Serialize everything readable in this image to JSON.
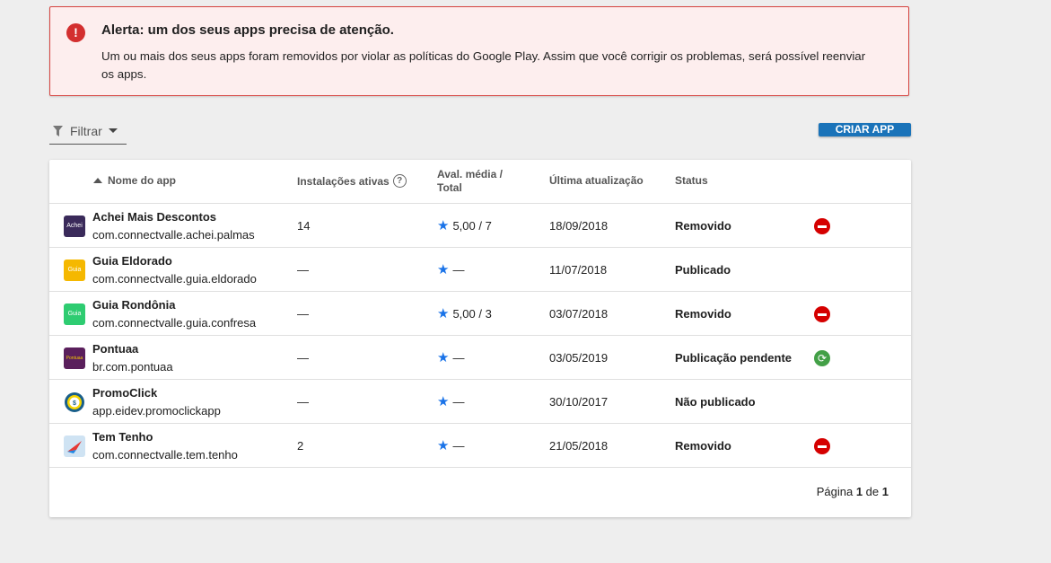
{
  "alert": {
    "icon": "error-icon",
    "title": "Alerta: um dos seus apps precisa de atenção.",
    "body": "Um ou mais dos seus apps foram removidos por violar as políticas do Google Play. Assim que você corrigir os problemas, será possível reenviar os apps."
  },
  "toolbar": {
    "filter_label": "Filtrar",
    "create_label": "CRIAR APP"
  },
  "table": {
    "headers": {
      "name": "Nome do app",
      "installs": "Instalações ativas",
      "rating": "Aval. média / Total",
      "updated": "Última atualização",
      "status": "Status"
    },
    "rows": [
      {
        "name": "Achei Mais Descontos",
        "package": "com.connectvalle.achei.palmas",
        "installs": "14",
        "rating": "5,00 / 7",
        "updated": "18/09/2018",
        "status": "Removido",
        "status_icon": "removed-icon",
        "icon_text": "Achei"
      },
      {
        "name": "Guia Eldorado",
        "package": "com.connectvalle.guia.eldorado",
        "installs": "—",
        "rating": "—",
        "updated": "11/07/2018",
        "status": "Publicado",
        "status_icon": "",
        "icon_text": "Guia"
      },
      {
        "name": "Guia Rondônia",
        "package": "com.connectvalle.guia.confresa",
        "installs": "—",
        "rating": "5,00 / 3",
        "updated": "03/07/2018",
        "status": "Removido",
        "status_icon": "removed-icon",
        "icon_text": "Guia"
      },
      {
        "name": "Pontuaa",
        "package": "br.com.pontuaa",
        "installs": "—",
        "rating": "—",
        "updated": "03/05/2019",
        "status": "Publicação pendente",
        "status_icon": "pending-icon",
        "icon_text": "Pontuaa"
      },
      {
        "name": "PromoClick",
        "package": "app.eidev.promoclickapp",
        "installs": "—",
        "rating": "—",
        "updated": "30/10/2017",
        "status": "Não publicado",
        "status_icon": "",
        "icon_text": ""
      },
      {
        "name": "Tem Tenho",
        "package": "com.connectvalle.tem.tenho",
        "installs": "2",
        "rating": "—",
        "updated": "21/05/2018",
        "status": "Removido",
        "status_icon": "removed-icon",
        "icon_text": ""
      }
    ]
  },
  "pagination": {
    "prefix": "Página",
    "current": "1",
    "sep": "de",
    "total": "1"
  }
}
